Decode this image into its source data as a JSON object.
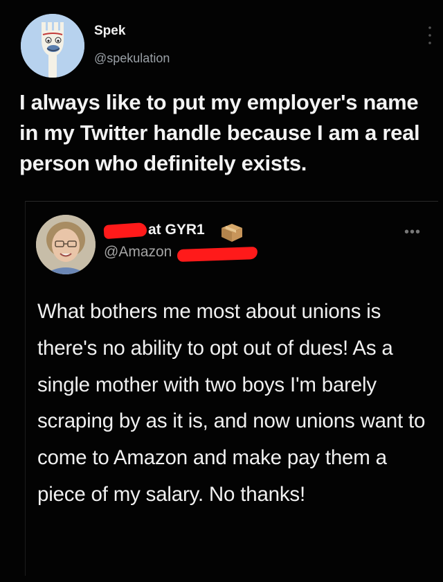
{
  "outer_tweet": {
    "display_name": "Spek",
    "handle": "@spekulation",
    "text": "I always like to put my employer's name in my Twitter handle because I am a real person who definitely exists.",
    "more_icon": "vertical-ellipsis-icon"
  },
  "quoted_tweet": {
    "display_name_suffix": "at GYR1",
    "handle_visible": "@Amazon",
    "name_emoji": "package-icon",
    "more_icon": "horizontal-ellipsis-icon",
    "text": "What bothers me most about unions is there's no ability to opt out of dues! As a single mother with two boys I'm barely scraping by as it is, and now unions want to come to Amazon and make pay them a piece of my salary. No thanks!"
  },
  "colors": {
    "background": "#030303",
    "text_primary": "#f2f2f2",
    "text_secondary": "#9aa0a6",
    "redaction": "#ff1a1a"
  }
}
